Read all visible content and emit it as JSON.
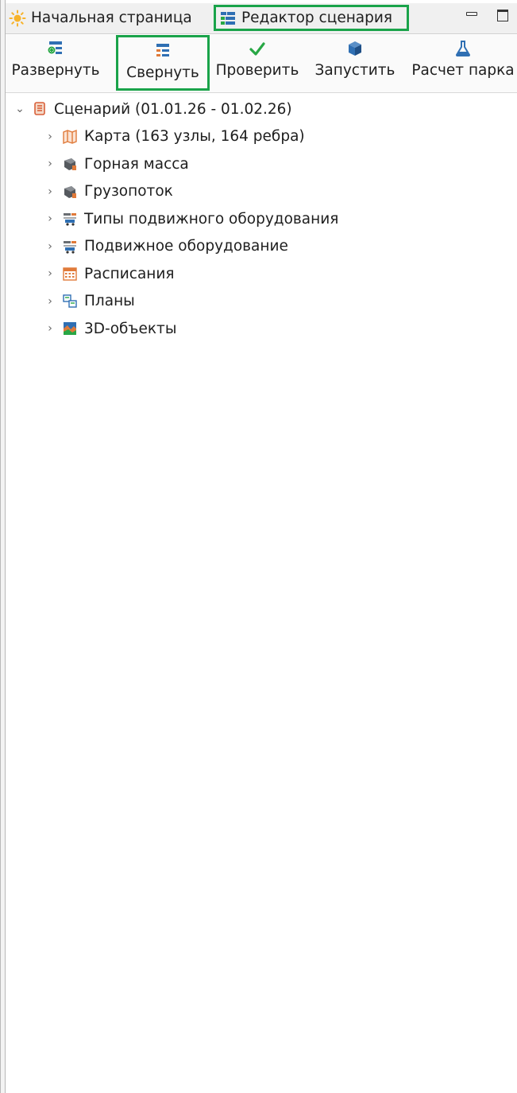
{
  "tabs": {
    "home": "Начальная страница",
    "editor": "Редактор сценария"
  },
  "toolbar": {
    "expand": "Развернуть",
    "collapse": "Свернуть",
    "check": "Проверить",
    "run": "Запустить",
    "fleet_calc": "Расчет парка"
  },
  "tree": {
    "root": "Сценарий (01.01.26 - 01.02.26)",
    "items": [
      {
        "label": "Карта (163 узлы, 164 ребра)",
        "icon": "map-icon"
      },
      {
        "label": "Горная масса",
        "icon": "rock-mass-icon"
      },
      {
        "label": "Грузопоток",
        "icon": "cargo-flow-icon"
      },
      {
        "label": "Типы подвижного оборудования",
        "icon": "equipment-types-icon"
      },
      {
        "label": "Подвижное оборудование",
        "icon": "equipment-icon"
      },
      {
        "label": "Расписания",
        "icon": "calendar-icon"
      },
      {
        "label": "Планы",
        "icon": "plans-icon"
      },
      {
        "label": "3D-объекты",
        "icon": "3d-objects-icon"
      }
    ]
  },
  "colors": {
    "highlight": "#1aa34a",
    "accent_blue": "#2f6fb3",
    "accent_green": "#28a745",
    "accent_orange": "#e07a3a"
  }
}
